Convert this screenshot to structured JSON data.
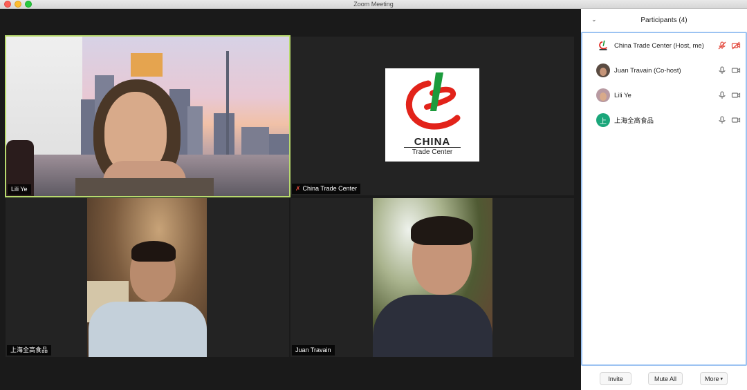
{
  "window": {
    "title": "Zoom Meeting"
  },
  "videos": [
    {
      "name": "Lili Ye",
      "speaking": true,
      "muted": false
    },
    {
      "name": "China Trade Center",
      "speaking": false,
      "muted": true
    },
    {
      "name": "上海全高食品",
      "speaking": false,
      "muted": false
    },
    {
      "name": "Juan Travain",
      "speaking": false,
      "muted": false
    }
  ],
  "logo": {
    "line1": "CHINA",
    "line2": "Trade Center"
  },
  "participants": {
    "title": "Participants (4)",
    "items": [
      {
        "name": "China Trade Center (Host, me)",
        "mic": "muted",
        "video": "off"
      },
      {
        "name": "Juan Travain (Co-host)",
        "mic": "on",
        "video": "on"
      },
      {
        "name": "Lili Ye",
        "mic": "on",
        "video": "on"
      },
      {
        "name": "上海全高食品",
        "mic": "on",
        "video": "on",
        "avatar_letter": "上"
      }
    ]
  },
  "footer": {
    "invite": "Invite",
    "mute_all": "Mute All",
    "more": "More"
  },
  "colors": {
    "speaker_border": "#b8da6e",
    "muted_red": "#e34b3f",
    "list_border": "#9cc3f2",
    "avatar_teal": "#1aa67a"
  }
}
